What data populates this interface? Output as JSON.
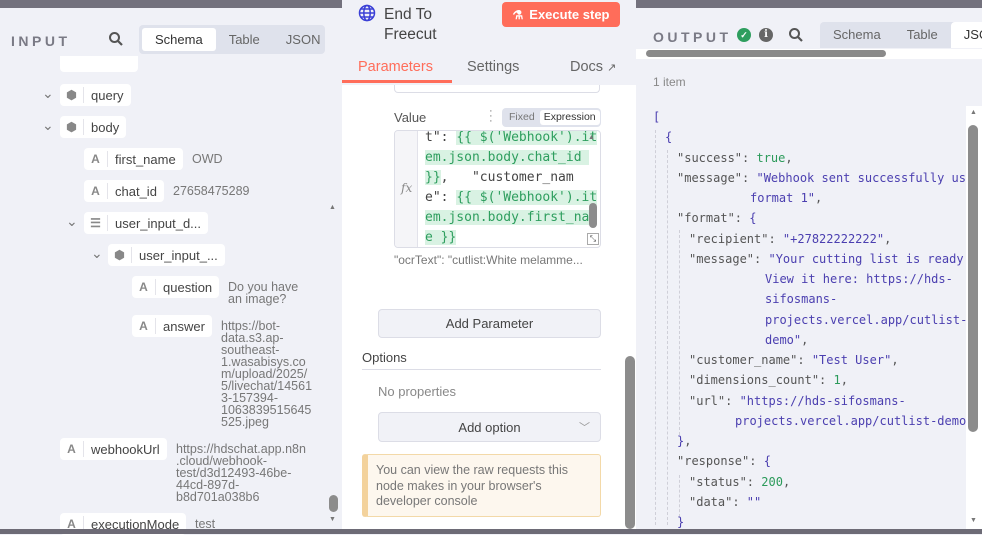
{
  "input": {
    "title": "INPUT",
    "tabs": [
      "Schema",
      "Table",
      "JSON"
    ],
    "tree": [
      {
        "name": "query",
        "type": "object"
      },
      {
        "name": "body",
        "type": "object"
      },
      {
        "name": "first_name",
        "type": "string",
        "value": "OWD"
      },
      {
        "name": "chat_id",
        "type": "string",
        "value": "27658475289"
      },
      {
        "name": "user_input_d...",
        "type": "array"
      },
      {
        "name": "user_input_...",
        "type": "object"
      },
      {
        "name": "question",
        "type": "string",
        "value": "Do you have\nan image?"
      },
      {
        "name": "answer",
        "type": "string",
        "value": "https://bot-\ndata.s3.ap-\nsoutheast-\n1.wasabisys.co\nm/upload/2025/\n5/livechat/14561\n3-157394-\n1063839515645\n525.jpeg"
      },
      {
        "name": "webhookUrl",
        "type": "string",
        "value": "https://hdschat.app.n8n\n.cloud/webhook-\ntest/d3d12493-46be-\n44cd-897d-\nb8d701a038b6"
      },
      {
        "name": "executionMode",
        "type": "string",
        "value": "test"
      }
    ]
  },
  "node": {
    "title": "End To\nFreecut",
    "execute_label": "Execute step",
    "tabs": [
      "Parameters",
      "Settings",
      "Docs"
    ],
    "value_label": "Value",
    "mode_options": [
      "Fixed",
      "Expression"
    ],
    "code_lines": [
      [
        {
          "t": "t\": ",
          "e": false
        },
        {
          "t": "{{ $('Webhook').it",
          "e": true
        }
      ],
      [
        {
          "t": "em.json.body.chat_id ",
          "e": true
        }
      ],
      [
        {
          "t": "}}",
          "e": true
        },
        {
          "t": ",   \"customer_nam",
          "e": false
        }
      ],
      [
        {
          "t": "e\": ",
          "e": false
        },
        {
          "t": "{{ $('Webhook').it",
          "e": true
        }
      ],
      [
        {
          "t": "em.json.body.first_nam",
          "e": true
        }
      ],
      [
        {
          "t": "e }}",
          "e": true
        }
      ]
    ],
    "fx": "fx",
    "ocr_preview": "\"ocrText\": \"cutlist:White melamme...",
    "add_parameter": "Add Parameter",
    "options_title": "Options",
    "no_properties": "No properties",
    "add_option": "Add option",
    "notice": "You can view the raw requests this node makes in your browser's developer console",
    "accent": "#ff6d5a"
  },
  "output": {
    "title": "OUTPUT",
    "tabs": [
      "Schema",
      "Table",
      "JSON"
    ],
    "count": "1 item",
    "json_lines": [
      [
        [
          "p",
          "["
        ]
      ],
      [
        [
          "p",
          "{"
        ]
      ],
      [
        [
          "k",
          "\"success\": "
        ],
        [
          "n",
          "true"
        ],
        [
          "k",
          ","
        ]
      ],
      [
        [
          "k",
          "\"message\": "
        ],
        [
          "s",
          "\"Webhook sent successfully using"
        ]
      ],
      [
        [
          "s",
          "format 1\""
        ],
        [
          "k",
          ","
        ]
      ],
      [
        [
          "k",
          "\"format\": "
        ],
        [
          "p",
          "{"
        ]
      ],
      [
        [
          "k",
          "\"recipient\": "
        ],
        [
          "s",
          "\"+27822222222\""
        ],
        [
          "k",
          ","
        ]
      ],
      [
        [
          "k",
          "\"message\": "
        ],
        [
          "s",
          "\"Your cutting list is ready!"
        ]
      ],
      [
        [
          "s",
          "View it here: https://hds-"
        ]
      ],
      [
        [
          "s",
          "sifosmans-"
        ]
      ],
      [
        [
          "s",
          "projects.vercel.app/cutlist-"
        ]
      ],
      [
        [
          "s",
          "demo\""
        ],
        [
          "k",
          ","
        ]
      ],
      [
        [
          "k",
          "\"customer_name\": "
        ],
        [
          "s",
          "\"Test User\""
        ],
        [
          "k",
          ","
        ]
      ],
      [
        [
          "k",
          "\"dimensions_count\": "
        ],
        [
          "n",
          "1"
        ],
        [
          "k",
          ","
        ]
      ],
      [
        [
          "k",
          "\"url\": "
        ],
        [
          "s",
          "\"https://hds-sifosmans-"
        ]
      ],
      [
        [
          "s",
          "projects.vercel.app/cutlist-demo\""
        ]
      ],
      [
        [
          "p",
          "}"
        ],
        [
          "k",
          ","
        ]
      ],
      [
        [
          "k",
          "\"response\": "
        ],
        [
          "p",
          "{"
        ]
      ],
      [
        [
          "k",
          "\"status\": "
        ],
        [
          "n",
          "200"
        ],
        [
          "k",
          ","
        ]
      ],
      [
        [
          "k",
          "\"data\": "
        ],
        [
          "s",
          "\"\""
        ]
      ],
      [
        [
          "p",
          "}"
        ]
      ]
    ]
  }
}
